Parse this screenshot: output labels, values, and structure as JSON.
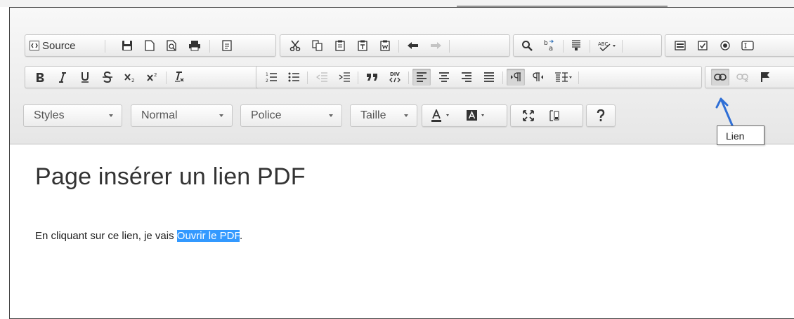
{
  "toolbar": {
    "source_label": "Source",
    "ol_glyph": "1≡",
    "quote_glyph": "99",
    "div_glyph": "DIV",
    "rtl_glyph": "¶‹"
  },
  "combos": {
    "styles": "Styles",
    "format": "Normal",
    "font": "Police",
    "size": "Taille"
  },
  "tooltip": {
    "text": "Lien"
  },
  "content": {
    "heading": "Page insérer un lien PDF",
    "para_before": "En cliquant sur ce lien, je vais ",
    "para_selected": "Ouvrir le PDF",
    "para_after": "."
  },
  "colors": {
    "selection": "#3399ff",
    "arrow": "#2f6fd6"
  }
}
